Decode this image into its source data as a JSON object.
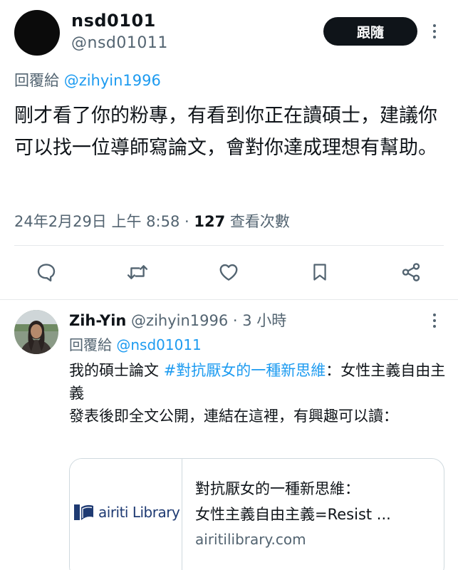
{
  "main_tweet": {
    "author_name": "nsd0101",
    "author_handle": "@nsd01011",
    "follow_label": "跟隨",
    "reply_prefix": "回覆給 ",
    "reply_to": "@zihyin1996",
    "text": "剛才看了你的粉專，有看到你正在讀碩士，建議你可以找一位導師寫論文，會對你達成理想有幫助。",
    "timestamp": "24年2月29日 上午 8:58",
    "dot": " · ",
    "views_count": "127",
    "views_label": " 查看次數",
    "actions": [
      "reply-icon",
      "retweet-icon",
      "like-icon",
      "bookmark-icon",
      "share-icon"
    ]
  },
  "reply_tweet": {
    "author_name": "Zih-Yin",
    "author_handle": " @zihyin1996",
    "time": " · 3 小時",
    "reply_prefix": "回覆給 ",
    "reply_to": "@nsd01011",
    "text_before_tag": "我的碩士論文 ",
    "hashtag": "#對抗厭女的一種新思維",
    "text_after_tag": "：女性主義自由主義",
    "text_line2": "發表後即全文公開，連結在這裡，有興趣可以讀：",
    "card": {
      "logo_text": "airiti Library",
      "title_line1": "對抗厭女的一種新思維：",
      "title_line2": "女性主義自由主義=Resist ...",
      "domain": "airitilibrary.com"
    }
  },
  "colors": {
    "accent": "#1d9bf0",
    "muted": "#536471",
    "text": "#0f1419",
    "divider": "#e6e9eb",
    "airiti_blue": "#1f3b73"
  }
}
